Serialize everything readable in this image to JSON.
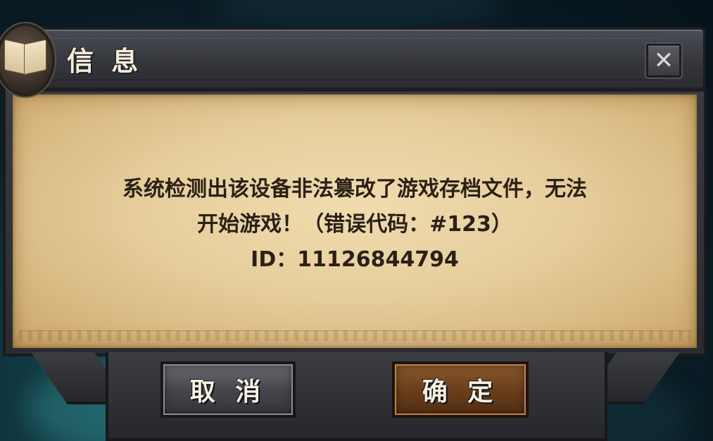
{
  "dialog": {
    "title": "信 息",
    "close_symbol": "✕",
    "message_lines": [
      "系统检测出该设备非法篡改了游戏存档文件，无法",
      "开始游戏！（错误代码：#123）",
      "ID：11126844794"
    ]
  },
  "buttons": {
    "cancel_label": "取 消",
    "confirm_label": "确 定"
  },
  "icons": {
    "header_icon": "open-book-icon",
    "close_icon": "close-icon"
  },
  "colors": {
    "parchment": "#e6cd9b",
    "text": "#2b2014",
    "frame": "#35373d",
    "confirm_button": "#6b3f1c",
    "cancel_button": "#45474d"
  }
}
